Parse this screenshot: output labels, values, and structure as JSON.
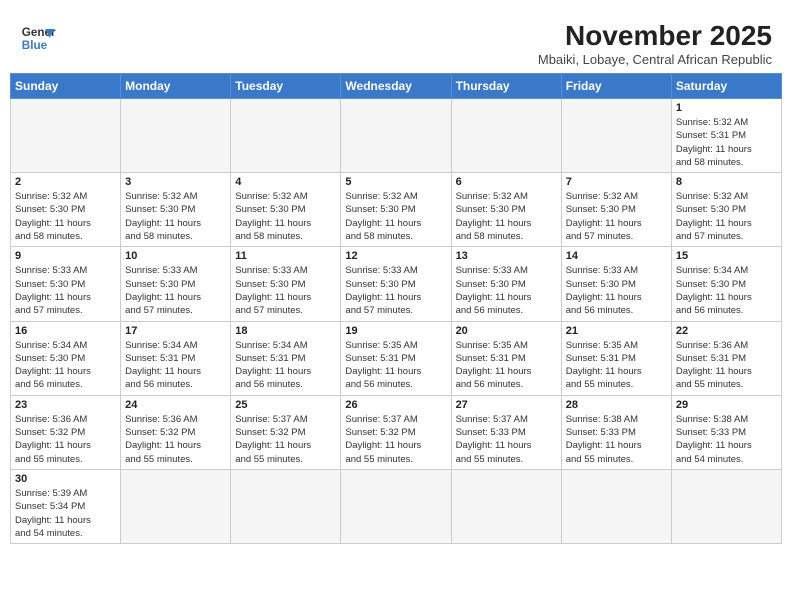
{
  "header": {
    "logo_line1": "General",
    "logo_line2": "Blue",
    "month": "November 2025",
    "subtitle": "Mbaiki, Lobaye, Central African Republic"
  },
  "days_of_week": [
    "Sunday",
    "Monday",
    "Tuesday",
    "Wednesday",
    "Thursday",
    "Friday",
    "Saturday"
  ],
  "weeks": [
    [
      {
        "day": "",
        "info": ""
      },
      {
        "day": "",
        "info": ""
      },
      {
        "day": "",
        "info": ""
      },
      {
        "day": "",
        "info": ""
      },
      {
        "day": "",
        "info": ""
      },
      {
        "day": "",
        "info": ""
      },
      {
        "day": "1",
        "info": "Sunrise: 5:32 AM\nSunset: 5:31 PM\nDaylight: 11 hours\nand 58 minutes."
      }
    ],
    [
      {
        "day": "2",
        "info": "Sunrise: 5:32 AM\nSunset: 5:30 PM\nDaylight: 11 hours\nand 58 minutes."
      },
      {
        "day": "3",
        "info": "Sunrise: 5:32 AM\nSunset: 5:30 PM\nDaylight: 11 hours\nand 58 minutes."
      },
      {
        "day": "4",
        "info": "Sunrise: 5:32 AM\nSunset: 5:30 PM\nDaylight: 11 hours\nand 58 minutes."
      },
      {
        "day": "5",
        "info": "Sunrise: 5:32 AM\nSunset: 5:30 PM\nDaylight: 11 hours\nand 58 minutes."
      },
      {
        "day": "6",
        "info": "Sunrise: 5:32 AM\nSunset: 5:30 PM\nDaylight: 11 hours\nand 58 minutes."
      },
      {
        "day": "7",
        "info": "Sunrise: 5:32 AM\nSunset: 5:30 PM\nDaylight: 11 hours\nand 57 minutes."
      },
      {
        "day": "8",
        "info": "Sunrise: 5:32 AM\nSunset: 5:30 PM\nDaylight: 11 hours\nand 57 minutes."
      }
    ],
    [
      {
        "day": "9",
        "info": "Sunrise: 5:33 AM\nSunset: 5:30 PM\nDaylight: 11 hours\nand 57 minutes."
      },
      {
        "day": "10",
        "info": "Sunrise: 5:33 AM\nSunset: 5:30 PM\nDaylight: 11 hours\nand 57 minutes."
      },
      {
        "day": "11",
        "info": "Sunrise: 5:33 AM\nSunset: 5:30 PM\nDaylight: 11 hours\nand 57 minutes."
      },
      {
        "day": "12",
        "info": "Sunrise: 5:33 AM\nSunset: 5:30 PM\nDaylight: 11 hours\nand 57 minutes."
      },
      {
        "day": "13",
        "info": "Sunrise: 5:33 AM\nSunset: 5:30 PM\nDaylight: 11 hours\nand 56 minutes."
      },
      {
        "day": "14",
        "info": "Sunrise: 5:33 AM\nSunset: 5:30 PM\nDaylight: 11 hours\nand 56 minutes."
      },
      {
        "day": "15",
        "info": "Sunrise: 5:34 AM\nSunset: 5:30 PM\nDaylight: 11 hours\nand 56 minutes."
      }
    ],
    [
      {
        "day": "16",
        "info": "Sunrise: 5:34 AM\nSunset: 5:30 PM\nDaylight: 11 hours\nand 56 minutes."
      },
      {
        "day": "17",
        "info": "Sunrise: 5:34 AM\nSunset: 5:31 PM\nDaylight: 11 hours\nand 56 minutes."
      },
      {
        "day": "18",
        "info": "Sunrise: 5:34 AM\nSunset: 5:31 PM\nDaylight: 11 hours\nand 56 minutes."
      },
      {
        "day": "19",
        "info": "Sunrise: 5:35 AM\nSunset: 5:31 PM\nDaylight: 11 hours\nand 56 minutes."
      },
      {
        "day": "20",
        "info": "Sunrise: 5:35 AM\nSunset: 5:31 PM\nDaylight: 11 hours\nand 56 minutes."
      },
      {
        "day": "21",
        "info": "Sunrise: 5:35 AM\nSunset: 5:31 PM\nDaylight: 11 hours\nand 55 minutes."
      },
      {
        "day": "22",
        "info": "Sunrise: 5:36 AM\nSunset: 5:31 PM\nDaylight: 11 hours\nand 55 minutes."
      }
    ],
    [
      {
        "day": "23",
        "info": "Sunrise: 5:36 AM\nSunset: 5:32 PM\nDaylight: 11 hours\nand 55 minutes."
      },
      {
        "day": "24",
        "info": "Sunrise: 5:36 AM\nSunset: 5:32 PM\nDaylight: 11 hours\nand 55 minutes."
      },
      {
        "day": "25",
        "info": "Sunrise: 5:37 AM\nSunset: 5:32 PM\nDaylight: 11 hours\nand 55 minutes."
      },
      {
        "day": "26",
        "info": "Sunrise: 5:37 AM\nSunset: 5:32 PM\nDaylight: 11 hours\nand 55 minutes."
      },
      {
        "day": "27",
        "info": "Sunrise: 5:37 AM\nSunset: 5:33 PM\nDaylight: 11 hours\nand 55 minutes."
      },
      {
        "day": "28",
        "info": "Sunrise: 5:38 AM\nSunset: 5:33 PM\nDaylight: 11 hours\nand 55 minutes."
      },
      {
        "day": "29",
        "info": "Sunrise: 5:38 AM\nSunset: 5:33 PM\nDaylight: 11 hours\nand 54 minutes."
      }
    ],
    [
      {
        "day": "30",
        "info": "Sunrise: 5:39 AM\nSunset: 5:34 PM\nDaylight: 11 hours\nand 54 minutes."
      },
      {
        "day": "",
        "info": ""
      },
      {
        "day": "",
        "info": ""
      },
      {
        "day": "",
        "info": ""
      },
      {
        "day": "",
        "info": ""
      },
      {
        "day": "",
        "info": ""
      },
      {
        "day": "",
        "info": ""
      }
    ]
  ]
}
